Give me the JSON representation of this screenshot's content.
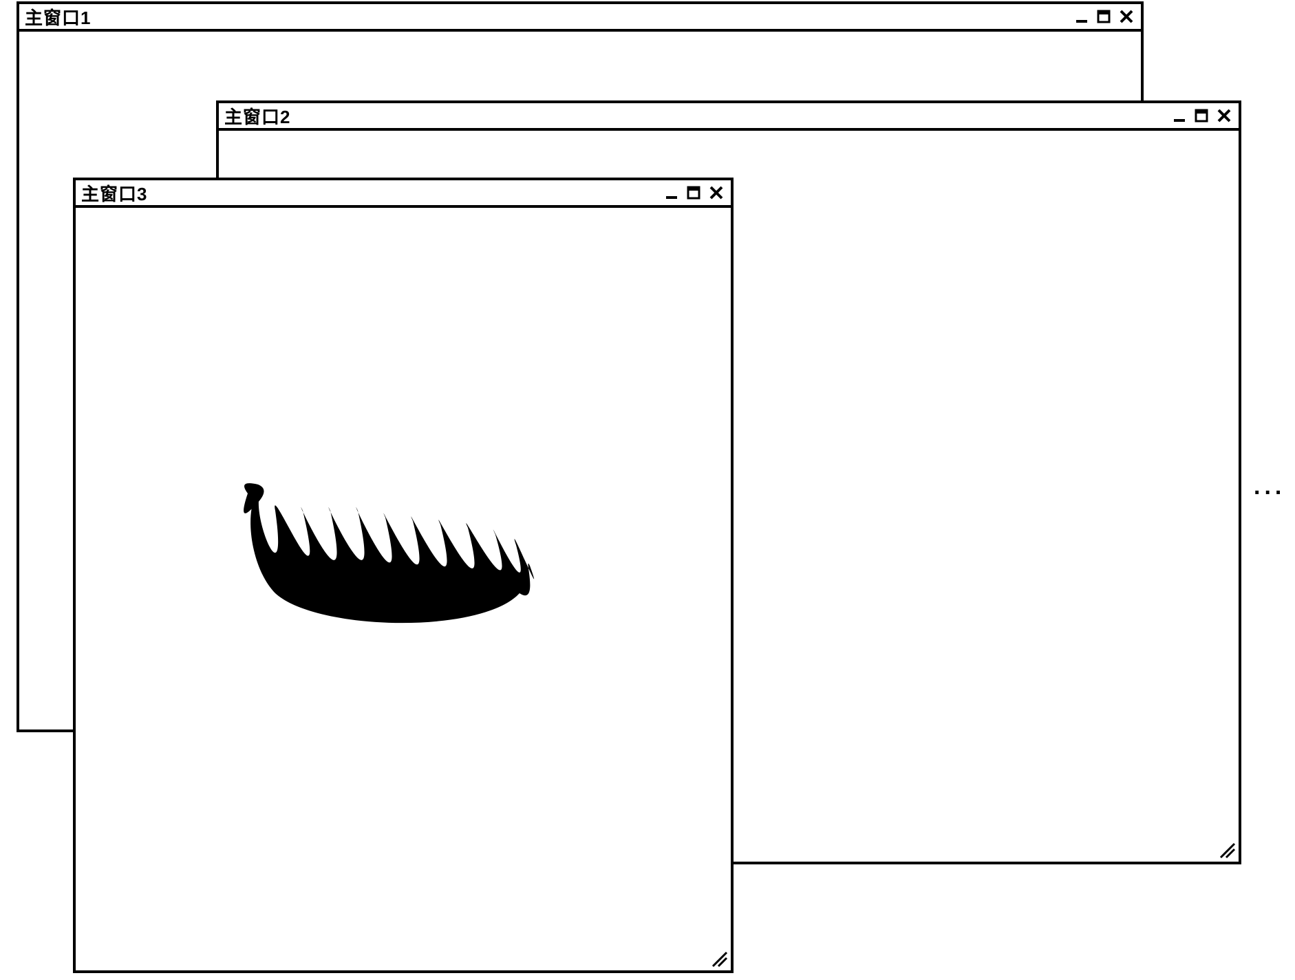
{
  "windows": [
    {
      "id": "win1",
      "title": "主窗口1",
      "has_grip": false
    },
    {
      "id": "win2",
      "title": "主窗口2",
      "has_grip": true
    },
    {
      "id": "win3",
      "title": "主窗口3",
      "has_grip": true
    }
  ],
  "ellipsis": "..."
}
